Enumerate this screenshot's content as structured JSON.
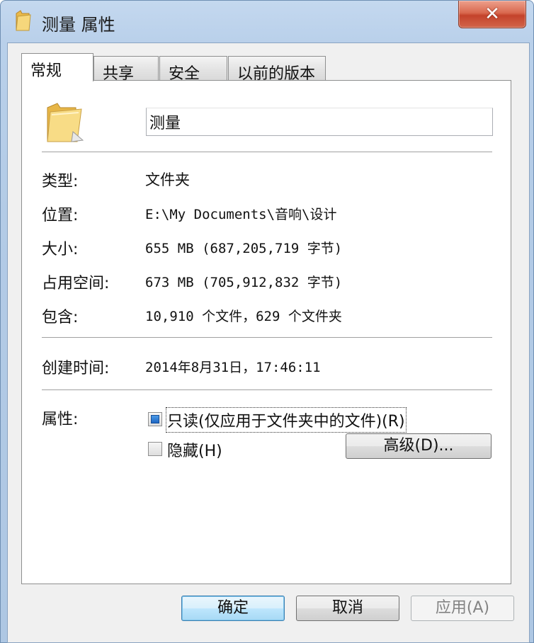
{
  "window": {
    "title": "测量 属性",
    "close_glyph": "✕"
  },
  "tabs": [
    {
      "label": "常规",
      "active": true
    },
    {
      "label": "共享",
      "active": false
    },
    {
      "label": "安全",
      "active": false
    },
    {
      "label": "以前的版本",
      "active": false
    }
  ],
  "general": {
    "name_value": "测量",
    "rows": {
      "type": {
        "label": "类型:",
        "value": "文件夹"
      },
      "location": {
        "label": "位置:",
        "value": "E:\\My Documents\\音响\\设计"
      },
      "size": {
        "label": "大小:",
        "value": "655 MB (687,205,719 字节)"
      },
      "ondisk": {
        "label": "占用空间:",
        "value": "673 MB (705,912,832 字节)"
      },
      "contains": {
        "label": "包含:",
        "value": "10,910 个文件，629 个文件夹"
      },
      "created": {
        "label": "创建时间:",
        "value": "2014年8月31日，17:46:11"
      }
    },
    "attributes": {
      "label": "属性:",
      "readonly_label": "只读(仅应用于文件夹中的文件)(R)",
      "readonly_state": "indeterminate",
      "hidden_label": "隐藏(H)",
      "hidden_state": "unchecked",
      "advanced_label": "高级(D)..."
    }
  },
  "buttons": {
    "ok": "确定",
    "cancel": "取消",
    "apply": "应用(A)"
  },
  "icons": {
    "title_icon": "folder-icon",
    "main_icon": "folder-icon",
    "close": "close-icon"
  }
}
